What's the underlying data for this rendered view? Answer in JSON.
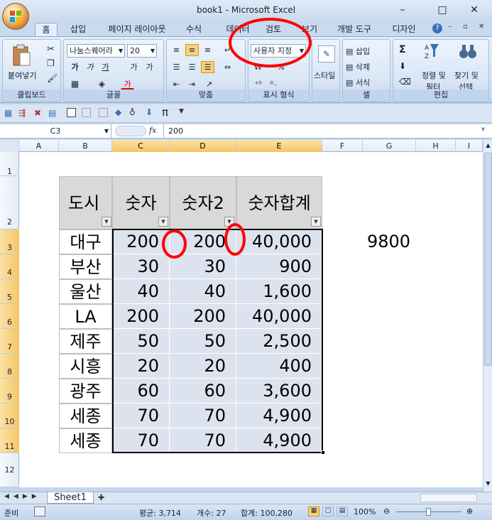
{
  "window": {
    "title": "book1 - Microsoft Excel"
  },
  "window_controls": {
    "minimize": "–",
    "maximize": "□",
    "close": "✕"
  },
  "tabs": [
    {
      "label": "홈"
    },
    {
      "label": "삽입"
    },
    {
      "label": "페이지 레이아웃"
    },
    {
      "label": "수식"
    },
    {
      "label": "데이터"
    },
    {
      "label": "검토"
    },
    {
      "label": "보기"
    },
    {
      "label": "개발 도구"
    },
    {
      "label": "디자인"
    }
  ],
  "ribbon": {
    "clipboard": {
      "paste": "붙여넣기",
      "label": "클립보드"
    },
    "font": {
      "name": "나눔스퀘어라",
      "size": "20",
      "label": "글꼴",
      "bold": "가",
      "italic": "가",
      "underline": "가",
      "grow": "가",
      "shrink": "가",
      "color_a": "가"
    },
    "alignment": {
      "label": "맞춤"
    },
    "number": {
      "format": "사용자 지정",
      "label": "표시 형식",
      "currency": "₩",
      "percent": "%"
    },
    "styles": {
      "label": "스타일"
    },
    "cells": {
      "insert": "삽입",
      "delete": "삭제",
      "format": "서식",
      "label": "셀"
    },
    "editing": {
      "sum": "Σ",
      "sort": "정렬 및",
      "sort2": "필터",
      "find": "찾기 및",
      "find2": "선택",
      "label": "편집"
    }
  },
  "formula_bar": {
    "name_box": "C3",
    "fx": "fx",
    "value": "200"
  },
  "columns": [
    "A",
    "B",
    "C",
    "D",
    "E",
    "F",
    "G",
    "H",
    "I"
  ],
  "rows": [
    "1",
    "2",
    "3",
    "4",
    "5",
    "6",
    "7",
    "8",
    "9",
    "10",
    "11",
    "12"
  ],
  "table": {
    "headers": [
      "도시",
      "숫자",
      "숫자2",
      "숫자합계"
    ],
    "rows": [
      [
        "대구",
        "200",
        "200",
        "40,000"
      ],
      [
        "부산",
        "30",
        "30",
        "900"
      ],
      [
        "울산",
        "40",
        "40",
        "1,600"
      ],
      [
        "LA",
        "200",
        "200",
        "40,000"
      ],
      [
        "제주",
        "50",
        "50",
        "2,500"
      ],
      [
        "시흥",
        "20",
        "20",
        "400"
      ],
      [
        "광주",
        "60",
        "60",
        "3,600"
      ],
      [
        "세종",
        "70",
        "70",
        "4,900"
      ],
      [
        "세종",
        "70",
        "70",
        "4,900"
      ]
    ]
  },
  "extra_cell": {
    "value": "9800"
  },
  "sheet_tab": {
    "label": "Sheet1"
  },
  "status": {
    "ready": "준비",
    "average": "평균: 3,714",
    "count": "개수: 27",
    "sum": "합계: 100,280",
    "zoom": "100%"
  },
  "colors": {
    "annotation": "#ff0000",
    "selected_header": "#f6c564",
    "table_header": "#d9d9d9",
    "table_data": "#dce3ef"
  }
}
